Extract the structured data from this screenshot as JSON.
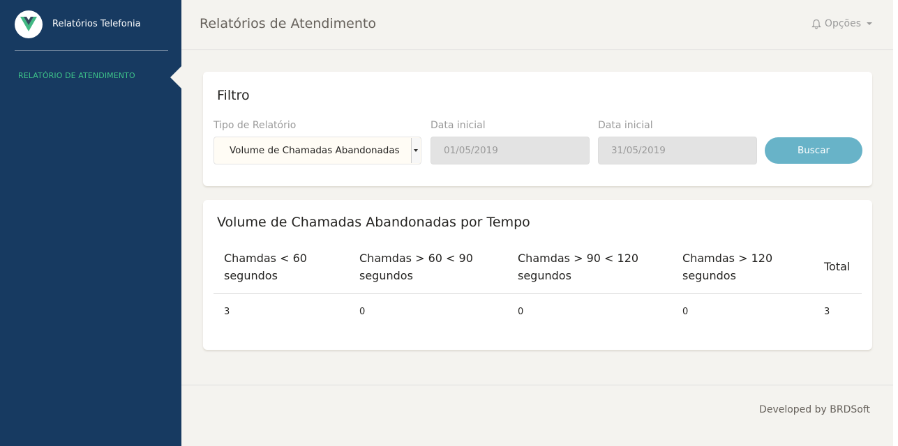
{
  "sidebar": {
    "brand_title": "Relatórios Telefonia",
    "logo_icon": "vue-logo-icon",
    "active_item": "RELATÓRIO DE ATENDIMENTO"
  },
  "header": {
    "title": "Relatórios de Atendimento",
    "options_label": "Opções",
    "options_icon": "bell-icon"
  },
  "filter": {
    "title": "Filtro",
    "report_type_label": "Tipo de Relatório",
    "report_type_value": "Volume de Chamadas Abandonadas",
    "start_date_label": "Data inicial",
    "start_date_value": "01/05/2019",
    "end_date_label": "Data inicial",
    "end_date_value": "31/05/2019",
    "search_label": "Buscar"
  },
  "report": {
    "title": "Volume de Chamadas Abandonadas por Tempo",
    "columns": [
      {
        "line1": "Chamdas < 60",
        "line2": "segundos"
      },
      {
        "line1": "Chamdas > 60 < 90",
        "line2": "segundos"
      },
      {
        "line1": "Chamdas > 90 < 120",
        "line2": "segundos"
      },
      {
        "line1": "Chamdas > 120",
        "line2": "segundos"
      },
      {
        "line1": "Total",
        "line2": ""
      }
    ],
    "rows": [
      [
        "3",
        "0",
        "0",
        "0",
        "3"
      ]
    ]
  },
  "footer": {
    "text": "Developed by BRDSoft"
  },
  "colors": {
    "sidebar_bg": "#173a61",
    "accent_green": "#3ec48a",
    "button_blue": "#68b3c8",
    "page_bg": "#f4f3ef"
  }
}
